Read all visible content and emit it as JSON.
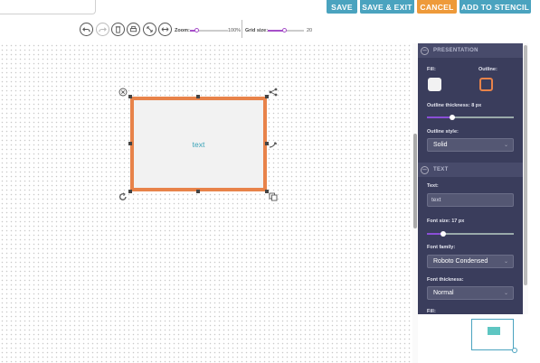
{
  "header": {
    "buttons": {
      "save": "SAVE",
      "save_exit": "SAVE & EXIT",
      "cancel": "CANCEL",
      "add_to_stencil": "ADD TO STENCIL"
    }
  },
  "toolbar": {
    "icons": [
      "undo-icon",
      "redo-icon",
      "delete-icon",
      "print-icon",
      "expand-icon",
      "fit-width-icon"
    ],
    "zoom_label": "Zoom:",
    "zoom_value": "100%",
    "zoom_level": 1.0,
    "grid_label": "Grid size:",
    "grid_value": "20"
  },
  "canvas": {
    "shape_text": "text"
  },
  "panel": {
    "presentation": {
      "title": "PRESENTATION",
      "fill_label": "Fill:",
      "outline_label": "Outline:",
      "fill_color": "#f2f2f2",
      "outline_color": "#e8834a",
      "outline_thickness_label": "Outline thickness:",
      "outline_thickness_value": "8 px",
      "outline_style_label": "Outline style:",
      "outline_style_value": "Solid"
    },
    "text": {
      "title": "TEXT",
      "text_label": "Text:",
      "text_value": "text",
      "font_size_label": "Font size:",
      "font_size_value": "17 px",
      "font_family_label": "Font family:",
      "font_family_value": "Roboto Condensed",
      "font_thickness_label": "Font thickness:",
      "font_thickness_value": "Normal",
      "fill_label": "Fill:"
    }
  },
  "colors": {
    "accent_blue": "#4aa3bf",
    "cancel_orange": "#ee9a3a",
    "panel_bg": "#3a3d5c",
    "slider_purple": "#8a4fd6",
    "text_teal": "#3aa3b8"
  }
}
